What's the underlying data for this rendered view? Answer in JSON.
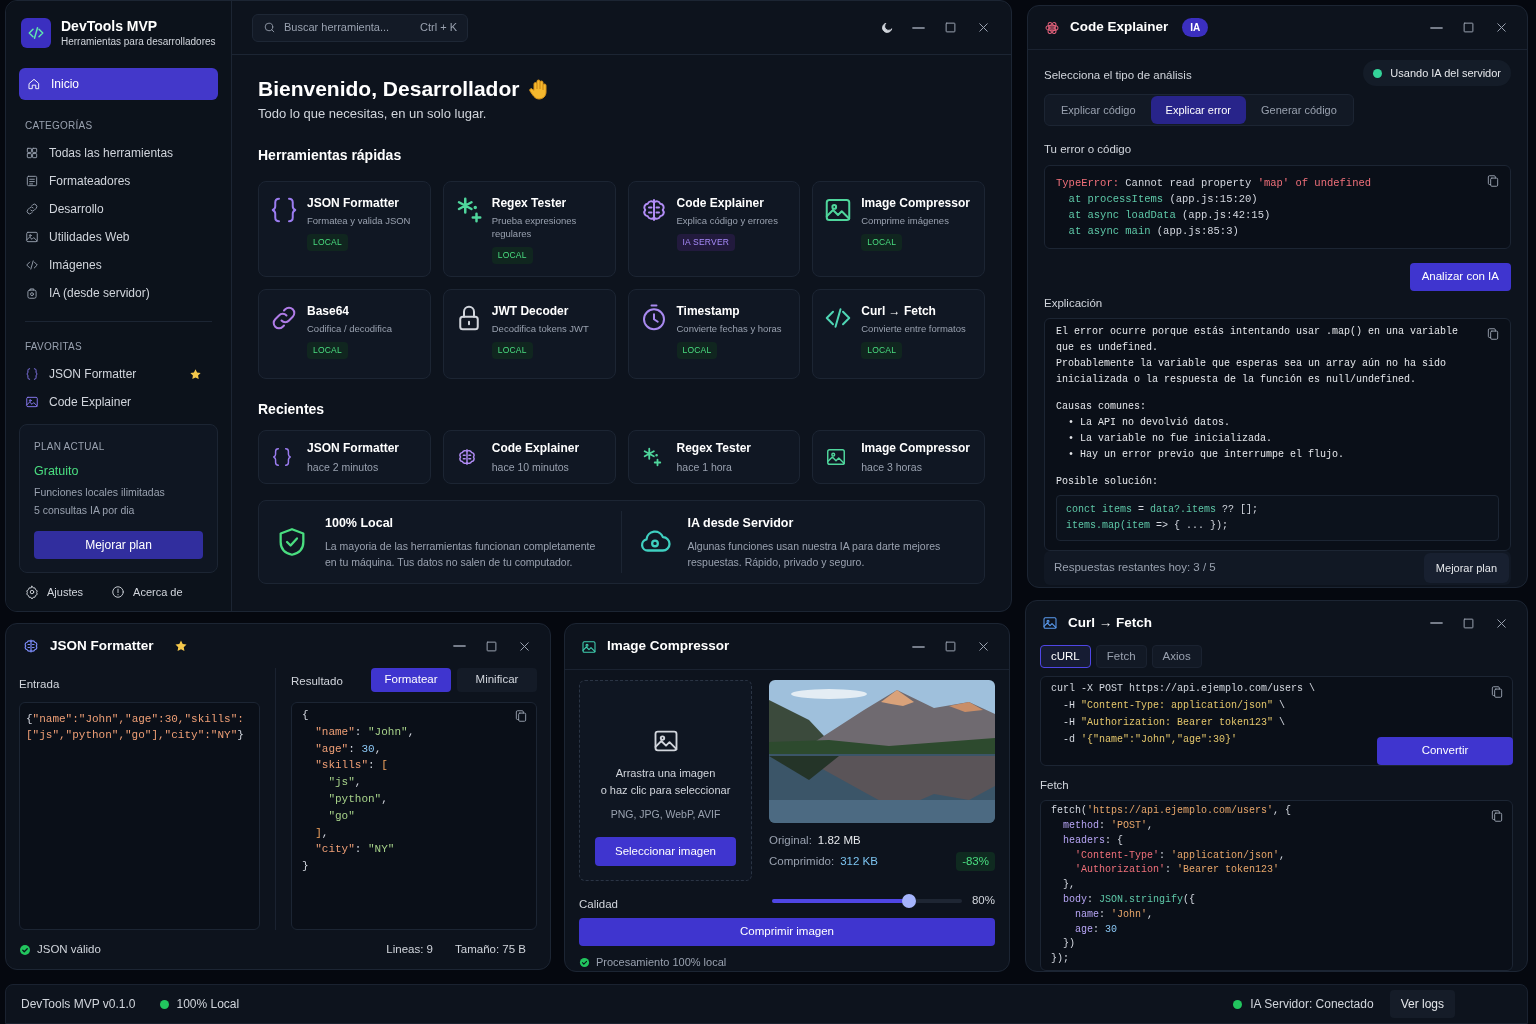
{
  "main_window": {
    "brand": {
      "title": "DevTools MVP",
      "subtitle": "Herramientas para desarrolladores"
    },
    "nav": [
      {
        "label": "Inicio",
        "selected": true
      }
    ],
    "categories": {
      "heading": "CATEGORÍAS",
      "items": [
        {
          "label": "Todas las herramientas"
        },
        {
          "label": "Formateadores"
        },
        {
          "label": "Desarrollo"
        },
        {
          "label": "Utilidades Web"
        },
        {
          "label": "Imágenes"
        },
        {
          "label": "IA (desde servidor)"
        }
      ]
    },
    "favorites": {
      "heading": "FAVORITAS",
      "items": [
        {
          "label": "JSON Formatter",
          "starred": true
        },
        {
          "label": "Code Explainer",
          "starred": false
        }
      ]
    },
    "plan": {
      "heading": "PLAN ACTUAL",
      "name": "Gratuito",
      "lines": [
        "Funciones locales ilimitadas",
        "5 consultas IA por dia"
      ],
      "button": "Mejorar plan"
    },
    "footer": [
      "Ajustes",
      "Acerca de"
    ],
    "search": {
      "placeholder": "Buscar herramienta...",
      "shortcut": "Ctrl + K"
    },
    "welcome": {
      "title": "Bienvenido, Desarrollador",
      "subtitle": "Todo lo que necesitas, en un solo lugar."
    },
    "quick_tools": {
      "heading": "Herramientas rápidas",
      "items": [
        {
          "name": "JSON Formatter",
          "description": "Formatea y valida JSON",
          "badge": {
            "kind": "local",
            "text": "LOCAL"
          }
        },
        {
          "name": "Regex Tester",
          "description": "Prueba expresiones regulares",
          "badge": {
            "kind": "local",
            "text": "LOCAL"
          }
        },
        {
          "name": "Code Explainer",
          "description": "Explica código y errores",
          "badge": {
            "kind": "ia",
            "text": "IA SERVER"
          }
        },
        {
          "name": "Image Compressor",
          "description": "Comprime imágenes",
          "badge": {
            "kind": "local",
            "text": "LOCAL"
          }
        },
        {
          "name": "Base64",
          "description": "Codifica / decodifica",
          "badge": {
            "kind": "local",
            "text": "LOCAL"
          }
        },
        {
          "name": "JWT Decoder",
          "description": "Decodifica tokens JWT",
          "badge": {
            "kind": "local",
            "text": "LOCAL"
          }
        },
        {
          "name": "Timestamp",
          "description": "Convierte fechas y horas",
          "badge": {
            "kind": "local",
            "text": "LOCAL"
          }
        },
        {
          "name": "Curl → Fetch",
          "description": "Convierte entre formatos",
          "badge": {
            "kind": "local",
            "text": "LOCAL"
          }
        }
      ]
    },
    "recents": {
      "heading": "Recientes",
      "items": [
        {
          "name": "JSON Formatter",
          "time": "hace 2 minutos"
        },
        {
          "name": "Code Explainer",
          "time": "hace 10 minutos"
        },
        {
          "name": "Regex Tester",
          "time": "hace 1 hora"
        },
        {
          "name": "Image Compressor",
          "time": "hace 3 horas"
        }
      ]
    },
    "info": [
      {
        "title": "100% Local",
        "text": "La mayoria de las herramientas funcionan completamente en tu máquina. Tus datos no salen de tu computador."
      },
      {
        "title": "IA desde Servidor",
        "text": "Algunas funciones usan nuestra IA para darte mejores respuestas. Rápido, privado y seguro."
      }
    ]
  },
  "code_explainer": {
    "title": "Code Explainer",
    "badge": "IA",
    "prompt": "Selecciona el tipo de análisis",
    "status": "Usando IA del servidor",
    "tabs": [
      {
        "label": "Explicar código",
        "selected": false
      },
      {
        "label": "Explicar error",
        "selected": true
      },
      {
        "label": "Generar código",
        "selected": false
      }
    ],
    "input_label": "Tu error o código",
    "input_lines": [
      [
        {
          "kind": "err",
          "text": "TypeError:"
        },
        {
          "kind": "plain",
          "text": " Cannot read property "
        },
        {
          "kind": "err",
          "text": "'map' of undefined"
        }
      ],
      [
        {
          "kind": "fn",
          "text": "  at processItems"
        },
        {
          "kind": "plain",
          "text": " (app.js:15:20)"
        }
      ],
      [
        {
          "kind": "fn",
          "text": "  at async loadData"
        },
        {
          "kind": "plain",
          "text": " (app.js:42:15)"
        }
      ],
      [
        {
          "kind": "fn",
          "text": "  at async main"
        },
        {
          "kind": "plain",
          "text": " (app.js:85:3)"
        }
      ]
    ],
    "button": "Analizar con IA",
    "output_label": "Explicación",
    "paragraphs": [
      "El error ocurre porque estás intentando usar .map() en una variable que es undefined.",
      "Probablemente la variable que esperas sea un array aún no ha sido inicializada o la respuesta de la función es null/undefined."
    ],
    "causes_heading": "Causas comunes:",
    "causes": [
      "• La API no devolvió datos.",
      "• La variable no fue inicializada.",
      "• Hay un error previo que interrumpe el flujo."
    ],
    "solution_heading": "Posible solución:",
    "solution_lines": [
      [
        {
          "kind": "fn",
          "text": "conct items"
        },
        {
          "kind": "plain",
          "text": " = "
        },
        {
          "kind": "fn",
          "text": "data?.items"
        },
        {
          "kind": "plain",
          "text": " ?? [];"
        }
      ],
      [
        {
          "kind": "fn",
          "text": "items.map(item"
        },
        {
          "kind": "plain",
          "text": " => { ... });"
        }
      ]
    ],
    "remaining": "Respuestas restantes hoy: 3 / 5",
    "upgrade": "Mejorar plan"
  },
  "json_formatter": {
    "title": "JSON Formatter",
    "starred": true,
    "input_label": "Entrada",
    "input_lines": [
      [
        {
          "kind": "plain",
          "text": "{"
        },
        {
          "kind": "key",
          "text": "\"name\":\"John\",\"age\":30,\"skills\":"
        }
      ],
      [
        {
          "kind": "key",
          "text": "[\"js\",\"python\",\"go\"],\"city\":\"NY\""
        },
        {
          "kind": "plain",
          "text": "}"
        }
      ]
    ],
    "output_label": "Resultado",
    "modes": [
      {
        "label": "Formatear",
        "selected": true
      },
      {
        "label": "Minificar",
        "selected": false
      }
    ],
    "output_lines": [
      [
        {
          "kind": "plain",
          "text": "{"
        }
      ],
      [
        {
          "kind": "key",
          "text": "  \"name\""
        },
        {
          "kind": "plain",
          "text": ": "
        },
        {
          "kind": "str",
          "text": "\"John\""
        },
        {
          "kind": "plain",
          "text": ","
        }
      ],
      [
        {
          "kind": "key",
          "text": "  \"age\""
        },
        {
          "kind": "plain",
          "text": ": "
        },
        {
          "kind": "num",
          "text": "30"
        },
        {
          "kind": "plain",
          "text": ","
        }
      ],
      [
        {
          "kind": "key",
          "text": "  \"skills\""
        },
        {
          "kind": "plain",
          "text": ": "
        },
        {
          "kind": "punct",
          "text": "["
        }
      ],
      [
        {
          "kind": "str",
          "text": "    \"js\""
        },
        {
          "kind": "plain",
          "text": ","
        }
      ],
      [
        {
          "kind": "str",
          "text": "    \"python\""
        },
        {
          "kind": "plain",
          "text": ","
        }
      ],
      [
        {
          "kind": "str",
          "text": "    \"go\""
        }
      ],
      [
        {
          "kind": "punct",
          "text": "  ]"
        },
        {
          "kind": "plain",
          "text": ","
        }
      ],
      [
        {
          "kind": "key",
          "text": "  \"city\""
        },
        {
          "kind": "plain",
          "text": ": "
        },
        {
          "kind": "str",
          "text": "\"NY\""
        }
      ],
      [
        {
          "kind": "plain",
          "text": "}"
        }
      ]
    ],
    "status": "JSON válido",
    "lines": "Lineas: 9",
    "size": "Tamaño: 75 B"
  },
  "image_compressor": {
    "title": "Image Compressor",
    "drop_lines": [
      "Arrastra una imagen",
      "o haz clic para seleccionar"
    ],
    "formats": "PNG, JPG, WebP, AVIF",
    "select_button": "Seleccionar imagen",
    "preview": {
      "kind": "picture"
    },
    "original_label": "Original:",
    "original_value": "1.82 MB",
    "compressed_label": "Comprimido:",
    "compressed_value": "312 KB",
    "reduction": "-83%",
    "quality": {
      "label": "Calidad",
      "level": 0.74,
      "reading": "80%"
    },
    "button": "Comprimir imagen",
    "footer": "Procesamiento 100% local"
  },
  "curl_fetch": {
    "title": "Curl → Fetch",
    "tabs": [
      {
        "label": "cURL",
        "selected": true
      },
      {
        "label": "Fetch",
        "selected": false
      },
      {
        "label": "Axios",
        "selected": false
      }
    ],
    "input_lines": [
      [
        {
          "kind": "plain",
          "text": "curl -X POST https://api.ejemplo.com/users \\"
        }
      ],
      [
        {
          "kind": "plain",
          "text": "  -H "
        },
        {
          "kind": "ystr",
          "text": "\"Content-Type: application/json\""
        },
        {
          "kind": "plain",
          "text": " \\"
        }
      ],
      [
        {
          "kind": "plain",
          "text": "  -H "
        },
        {
          "kind": "ystr",
          "text": "\"Authorization: Bearer token123\""
        },
        {
          "kind": "plain",
          "text": " \\"
        }
      ],
      [
        {
          "kind": "plain",
          "text": "  -d "
        },
        {
          "kind": "ystr",
          "text": "'{\"name\":\"John\",\"age\":30}'"
        }
      ]
    ],
    "button": "Convertir",
    "output_label": "Fetch",
    "output_lines": [
      [
        {
          "kind": "plain",
          "text": "fetch("
        },
        {
          "kind": "ostr",
          "text": "'https://api.ejemplo.com/users'"
        },
        {
          "kind": "plain",
          "text": ", {"
        }
      ],
      [
        {
          "kind": "prop",
          "text": "  method"
        },
        {
          "kind": "plain",
          "text": ": "
        },
        {
          "kind": "ostr",
          "text": "'POST'"
        },
        {
          "kind": "plain",
          "text": ","
        }
      ],
      [
        {
          "kind": "prop",
          "text": "  headers"
        },
        {
          "kind": "plain",
          "text": ": {"
        }
      ],
      [
        {
          "kind": "err",
          "text": "    'Content-Type'"
        },
        {
          "kind": "plain",
          "text": ": "
        },
        {
          "kind": "ostr",
          "text": "'application/json'"
        },
        {
          "kind": "plain",
          "text": ","
        }
      ],
      [
        {
          "kind": "err",
          "text": "    'Authorization'"
        },
        {
          "kind": "plain",
          "text": ": "
        },
        {
          "kind": "ostr",
          "text": "'Bearer token123'"
        }
      ],
      [
        {
          "kind": "plain",
          "text": "  },"
        }
      ],
      [
        {
          "kind": "prop",
          "text": "  body"
        },
        {
          "kind": "plain",
          "text": ": "
        },
        {
          "kind": "fn",
          "text": "JSON.stringify"
        },
        {
          "kind": "plain",
          "text": "({"
        }
      ],
      [
        {
          "kind": "prop",
          "text": "    name"
        },
        {
          "kind": "plain",
          "text": ": "
        },
        {
          "kind": "ostr",
          "text": "'John'"
        },
        {
          "kind": "plain",
          "text": ","
        }
      ],
      [
        {
          "kind": "prop",
          "text": "    age"
        },
        {
          "kind": "plain",
          "text": ": "
        },
        {
          "kind": "num",
          "text": "30"
        }
      ],
      [
        {
          "kind": "plain",
          "text": "  })"
        }
      ],
      [
        {
          "kind": "plain",
          "text": "});"
        }
      ]
    ]
  },
  "status_bar": {
    "version": "DevTools MVP v0.1.0",
    "local": "100% Local",
    "server": "IA Servidor: Conectado",
    "logs_button": "Ver logs"
  }
}
